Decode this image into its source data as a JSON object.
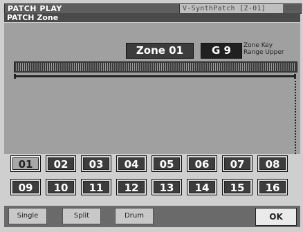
{
  "titlebar": {
    "title": "PATCH PLAY",
    "patch": "V-SynthPatch [Z-01]",
    "icon": "menu-lines-icon"
  },
  "subtitle": {
    "label": "PATCH Zone"
  },
  "zone": {
    "label": "Zone  01",
    "key": "G  9",
    "key_label_line1": "Zone Key",
    "key_label_line2": "Range Upper"
  },
  "zones": [
    "01",
    "02",
    "03",
    "04",
    "05",
    "06",
    "07",
    "08",
    "09",
    "10",
    "11",
    "12",
    "13",
    "14",
    "15",
    "16"
  ],
  "selected_zone": "01",
  "buttons": {
    "single": "Single",
    "split": "Split",
    "drum": "Drum",
    "ok": "OK"
  }
}
